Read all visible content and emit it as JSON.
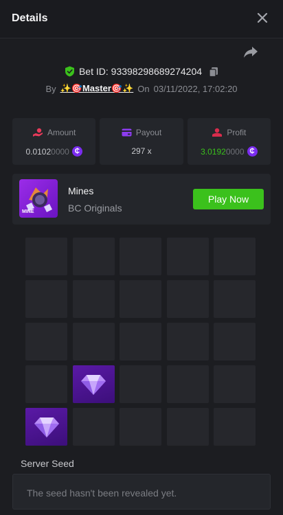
{
  "header": {
    "title": "Details"
  },
  "bet": {
    "id_text": "Bet ID: 93398298689274204",
    "by_label": "By",
    "user": "✨🎯Master🎯✨",
    "on_label": "On",
    "date": "03/11/2022, 17:02:20"
  },
  "stats": {
    "amount": {
      "label": "Amount",
      "value_main": "0.0102",
      "value_dim": "0000",
      "coin_icon": "bc-coin-icon"
    },
    "payout": {
      "label": "Payout",
      "value": "297 x"
    },
    "profit": {
      "label": "Profit",
      "value_main": "3.0192",
      "value_dim": "0000",
      "coin_icon": "bc-coin-icon"
    }
  },
  "game": {
    "name": "Mines",
    "provider": "BC Originals",
    "thumb_label": "MINE",
    "play_label": "Play Now"
  },
  "board": {
    "columns": 5,
    "rows": 5,
    "tiles": [
      "empty",
      "empty",
      "empty",
      "empty",
      "empty",
      "empty",
      "empty",
      "empty",
      "empty",
      "empty",
      "empty",
      "empty",
      "empty",
      "empty",
      "empty",
      "empty",
      "gem",
      "empty",
      "empty",
      "empty",
      "gem",
      "empty",
      "empty",
      "empty",
      "empty"
    ]
  },
  "server_seed": {
    "label": "Server Seed",
    "value": "The seed hasn't been revealed yet."
  },
  "colors": {
    "accent_green": "#3bc11c",
    "coin_purple": "#7b2cf0",
    "amount_red": "#e83a5a",
    "payout_purple": "#8d3cf0",
    "profit_red": "#d92c4c",
    "profit_text_green": "#3bc11c"
  }
}
